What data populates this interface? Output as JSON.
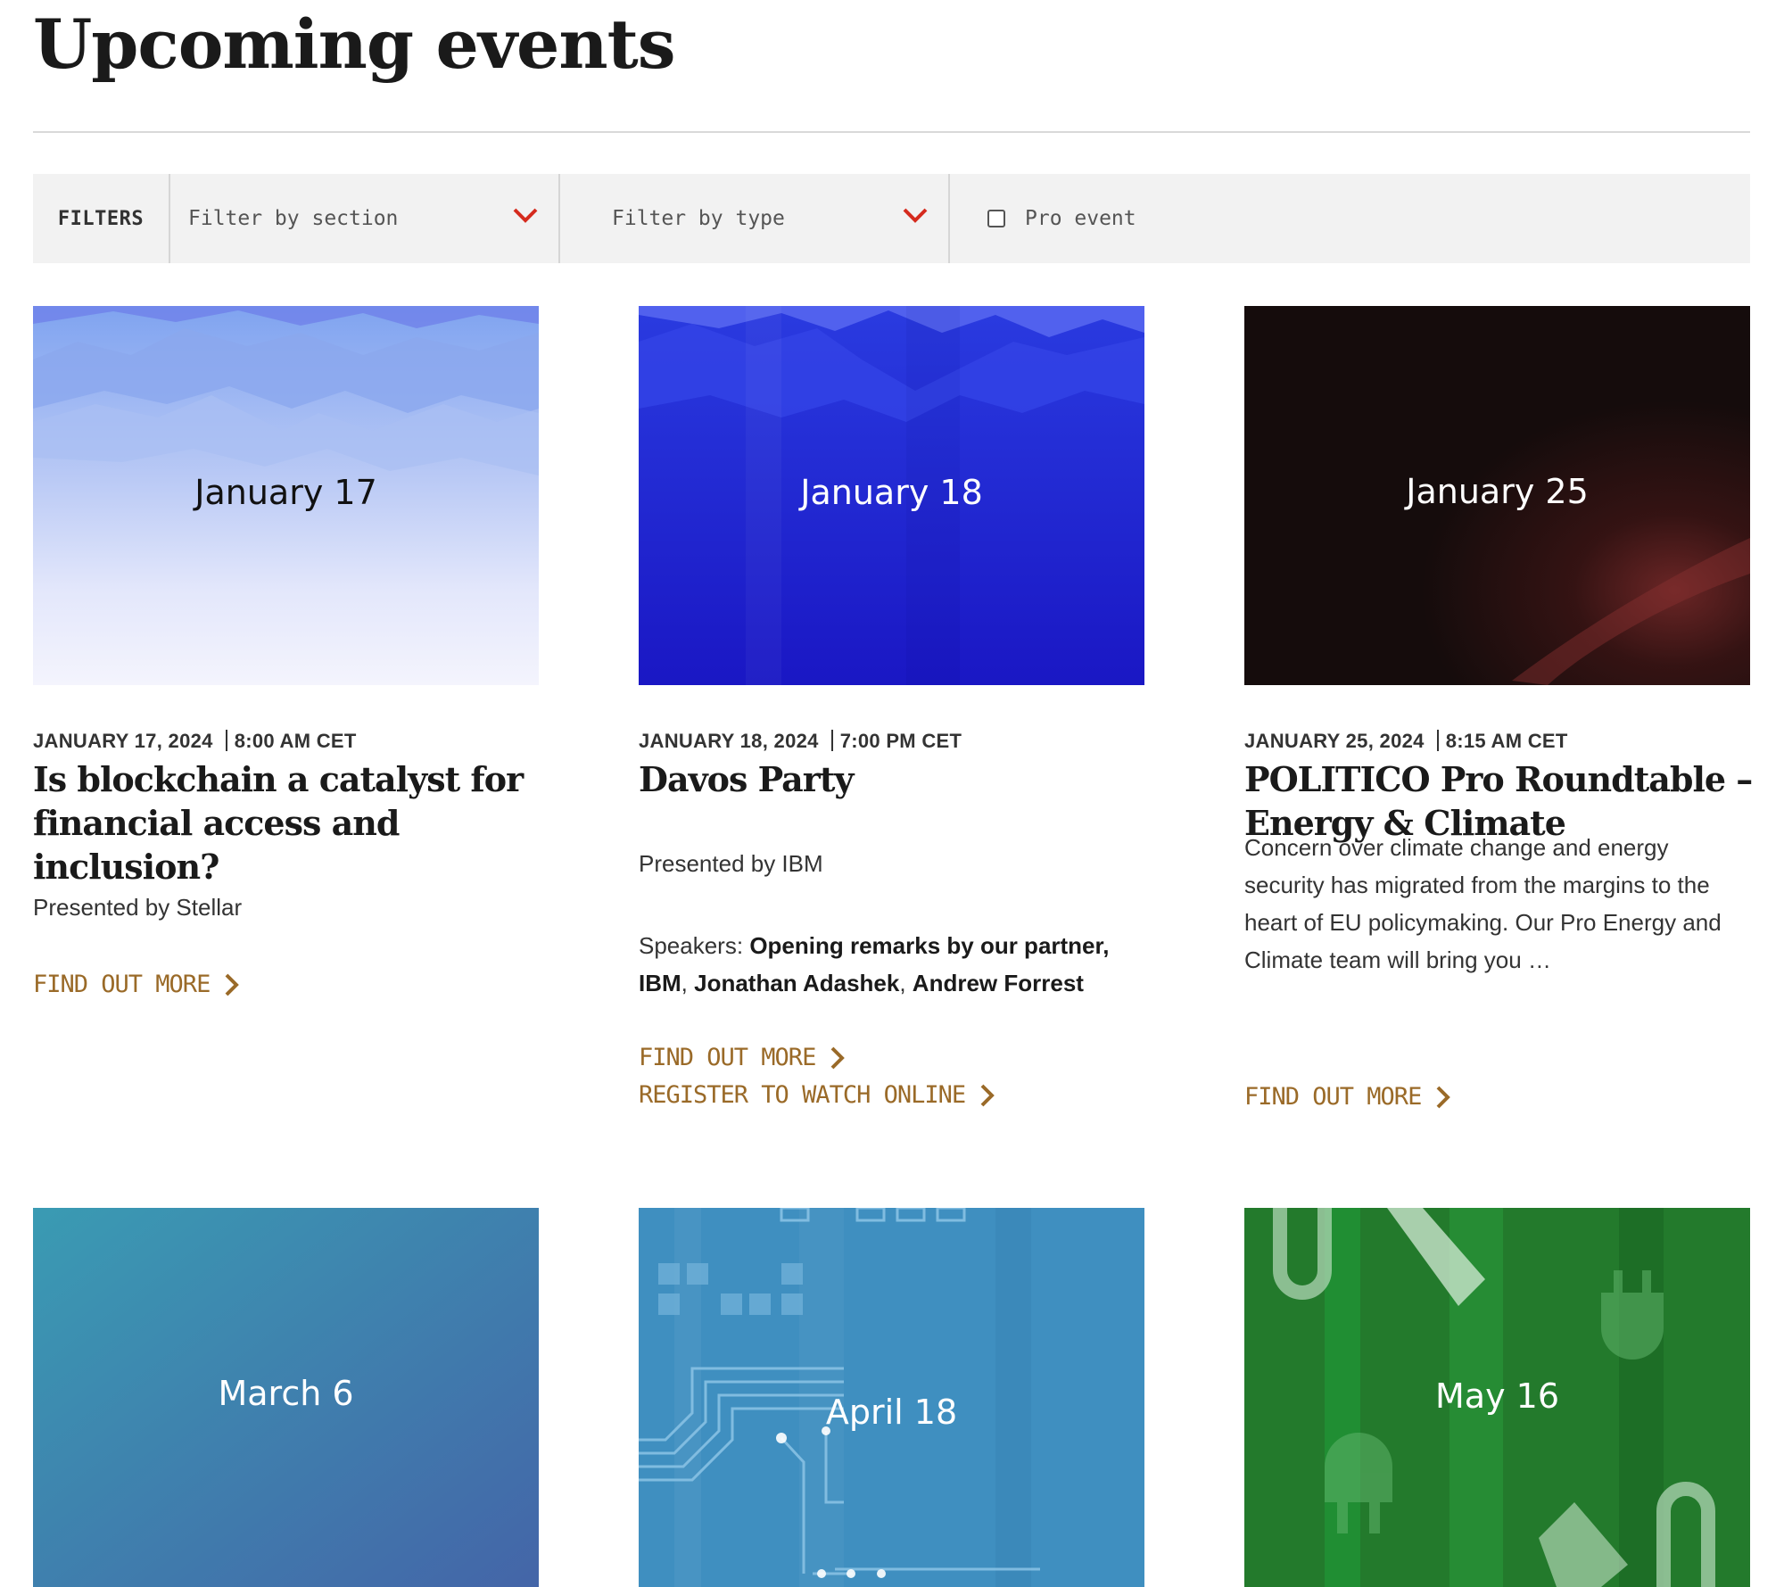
{
  "page": {
    "title": "Upcoming events"
  },
  "filters": {
    "label": "FILTERS",
    "section_placeholder": "Filter by section",
    "type_placeholder": "Filter by type",
    "pro_label": "Pro event",
    "accent_color": "#d52b1e"
  },
  "colors": {
    "link": "#9a6a28"
  },
  "events": [
    {
      "thumb_date": "January 17",
      "date": "JANUARY 17, 2024",
      "time": "8:00 AM CET",
      "title": "Is blockchain a catalyst for financial access and inclusion?",
      "presenter": "Presented by Stellar",
      "find_out_more": "FIND OUT MORE"
    },
    {
      "thumb_date": "January 18",
      "date": "JANUARY 18, 2024",
      "time": "7:00 PM CET",
      "title": "Davos Party",
      "presenter": "Presented by IBM",
      "speakers_label": "Speakers:",
      "speaker_1": "Opening remarks by our partner, IBM",
      "speaker_2": "Jonathan Adashek",
      "speaker_3": "Andrew Forrest",
      "find_out_more": "FIND OUT MORE",
      "register": "REGISTER TO WATCH ONLINE"
    },
    {
      "thumb_date": "January 25",
      "date": "JANUARY 25, 2024",
      "time": "8:15 AM CET",
      "title": "POLITICO Pro Roundtable – Energy & Climate",
      "description": "Concern over climate change and energy security has migrated from the margins to the heart of EU policymaking. Our Pro Energy and Climate team will bring you …",
      "find_out_more": "FIND OUT MORE"
    },
    {
      "thumb_date": "March 6"
    },
    {
      "thumb_date": "April 18"
    },
    {
      "thumb_date": "May 16"
    }
  ]
}
